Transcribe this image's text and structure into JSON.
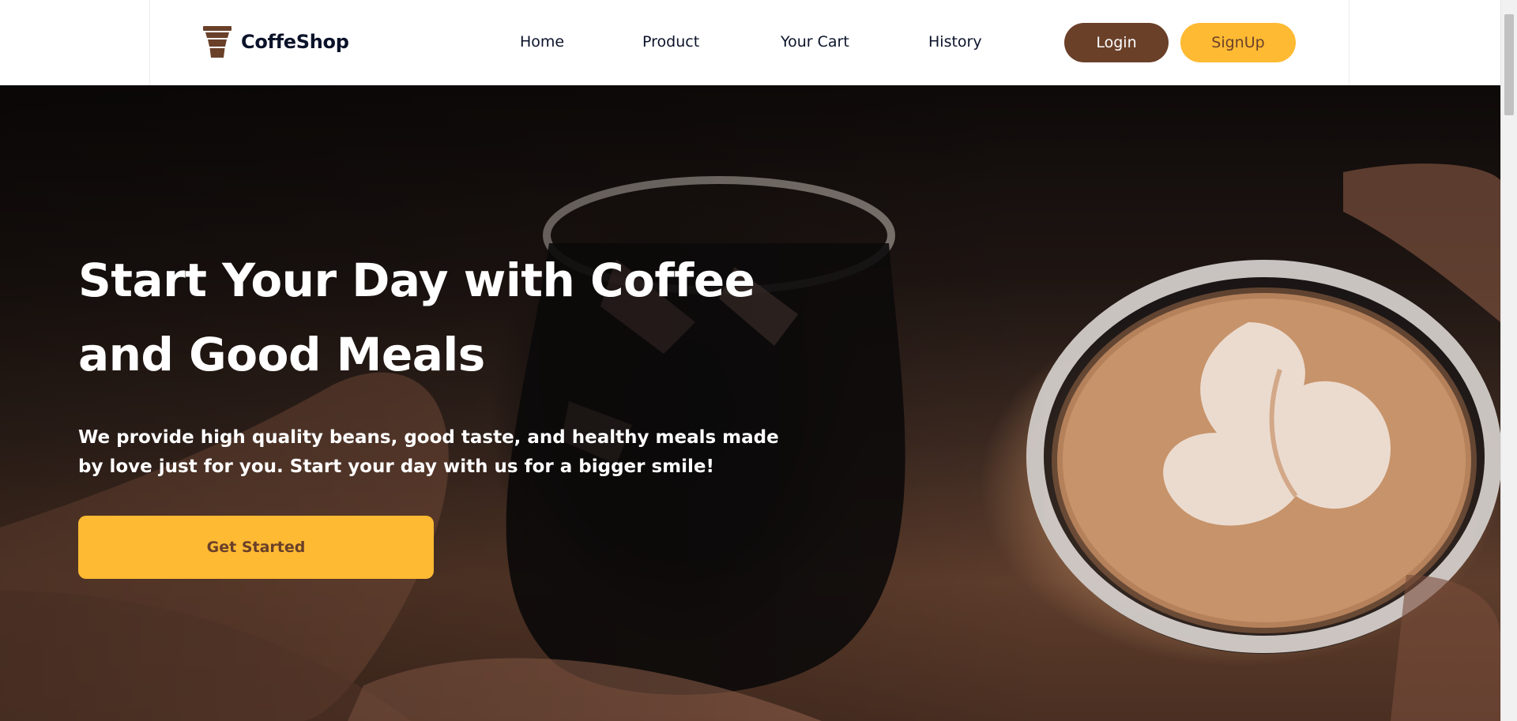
{
  "brand": {
    "name": "CoffeShop",
    "logo_icon": "coffee-cup-icon",
    "color": "#6a4029"
  },
  "nav": {
    "links": [
      {
        "label": "Home"
      },
      {
        "label": "Product"
      },
      {
        "label": "Your Cart"
      },
      {
        "label": "History"
      }
    ],
    "login_label": "Login",
    "signup_label": "SignUp"
  },
  "hero": {
    "title": "Start Your Day with Coffee and Good Meals",
    "subtitle": "We provide high quality beans, good taste, and healthy meals made by love just for you. Start your day with us for a bigger smile!",
    "cta_label": "Get Started"
  },
  "colors": {
    "primary_brown": "#6a4029",
    "accent_yellow": "#ffba33",
    "text_dark": "#0b132a"
  }
}
